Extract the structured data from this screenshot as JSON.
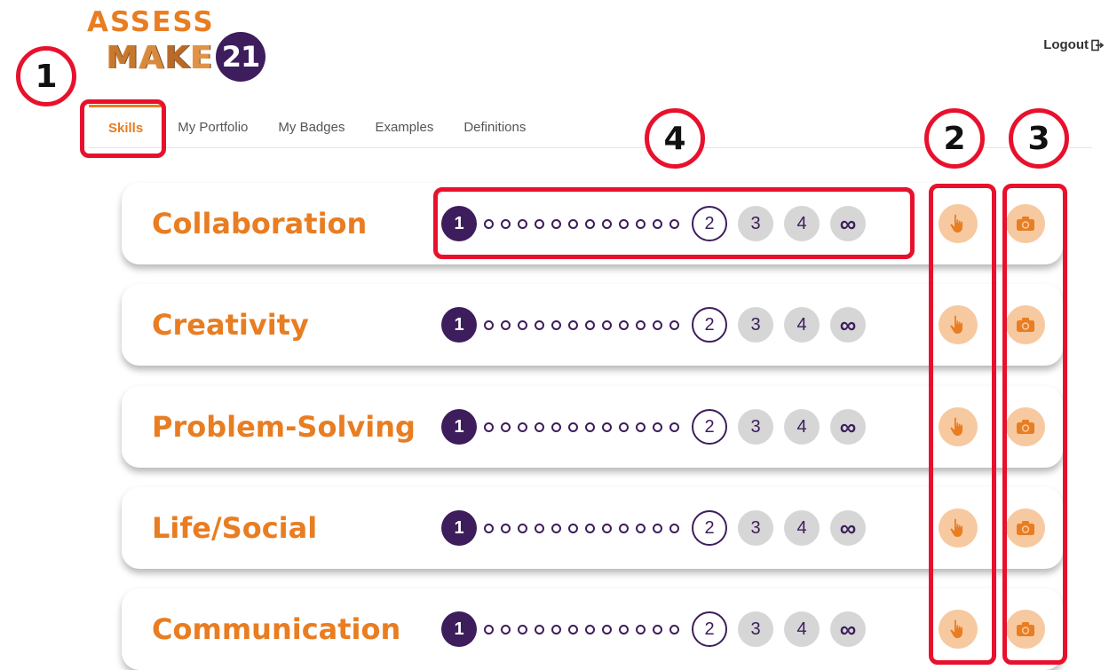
{
  "logo": {
    "line1": "ASSESS",
    "line2": [
      "M",
      "A",
      "K",
      "E"
    ],
    "badge": "21"
  },
  "header": {
    "logout_label": "Logout"
  },
  "tabs": [
    {
      "label": "Skills",
      "active": true
    },
    {
      "label": "My Portfolio",
      "active": false
    },
    {
      "label": "My Badges",
      "active": false
    },
    {
      "label": "Examples",
      "active": false
    },
    {
      "label": "Definitions",
      "active": false
    }
  ],
  "annotations": [
    "1",
    "2",
    "3",
    "4"
  ],
  "levels": {
    "first": "1",
    "current": "2",
    "l3": "3",
    "l4": "4",
    "infinity": "∞"
  },
  "skills": [
    {
      "name": "Collaboration"
    },
    {
      "name": "Creativity"
    },
    {
      "name": "Problem-Solving"
    },
    {
      "name": "Life/Social"
    },
    {
      "name": "Communication"
    }
  ],
  "colors": {
    "accent": "#e87d22",
    "brand_purple": "#3d1d5c",
    "annotation_red": "#e8112d",
    "action_bg": "#f7c9a0",
    "locked": "#d6d6d6"
  },
  "icons": {
    "tap": "hand-pointer-icon",
    "camera": "camera-icon",
    "logout": "logout-icon"
  }
}
